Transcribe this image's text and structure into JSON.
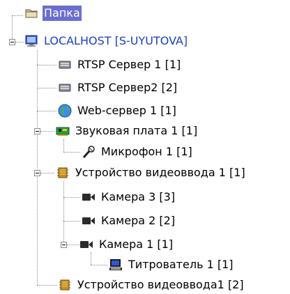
{
  "tree": {
    "folder_label": "Папка",
    "localhost_label": "LOCALHOST [S-UYUTOVA]",
    "rtsp1_label": "RTSP Сервер 1 [1]",
    "rtsp2_label": "RTSP Сервер2 [2]",
    "web_label": "Web-сервер 1 [1]",
    "sound_label": "Звуковая плата 1 [1]",
    "mic_label": "Микрофон 1 [1]",
    "video1_label": "Устройство видеоввода 1 [1]",
    "cam3_label": "Камера 3 [3]",
    "cam2_label": "Камера 2 [2]",
    "cam1_label": "Камера 1 [1]",
    "titler_label": "Титрователь 1 [1]",
    "video2_label": "Устройство видеоввода1 [2]"
  },
  "icons": {
    "folder": "folder-icon",
    "localhost": "computer-icon",
    "rtsp": "server-icon",
    "web": "globe-icon",
    "sound": "sound-card-icon",
    "mic": "microphone-icon",
    "video": "chip-icon",
    "camera": "camera-icon",
    "titler": "monitor-icon"
  }
}
